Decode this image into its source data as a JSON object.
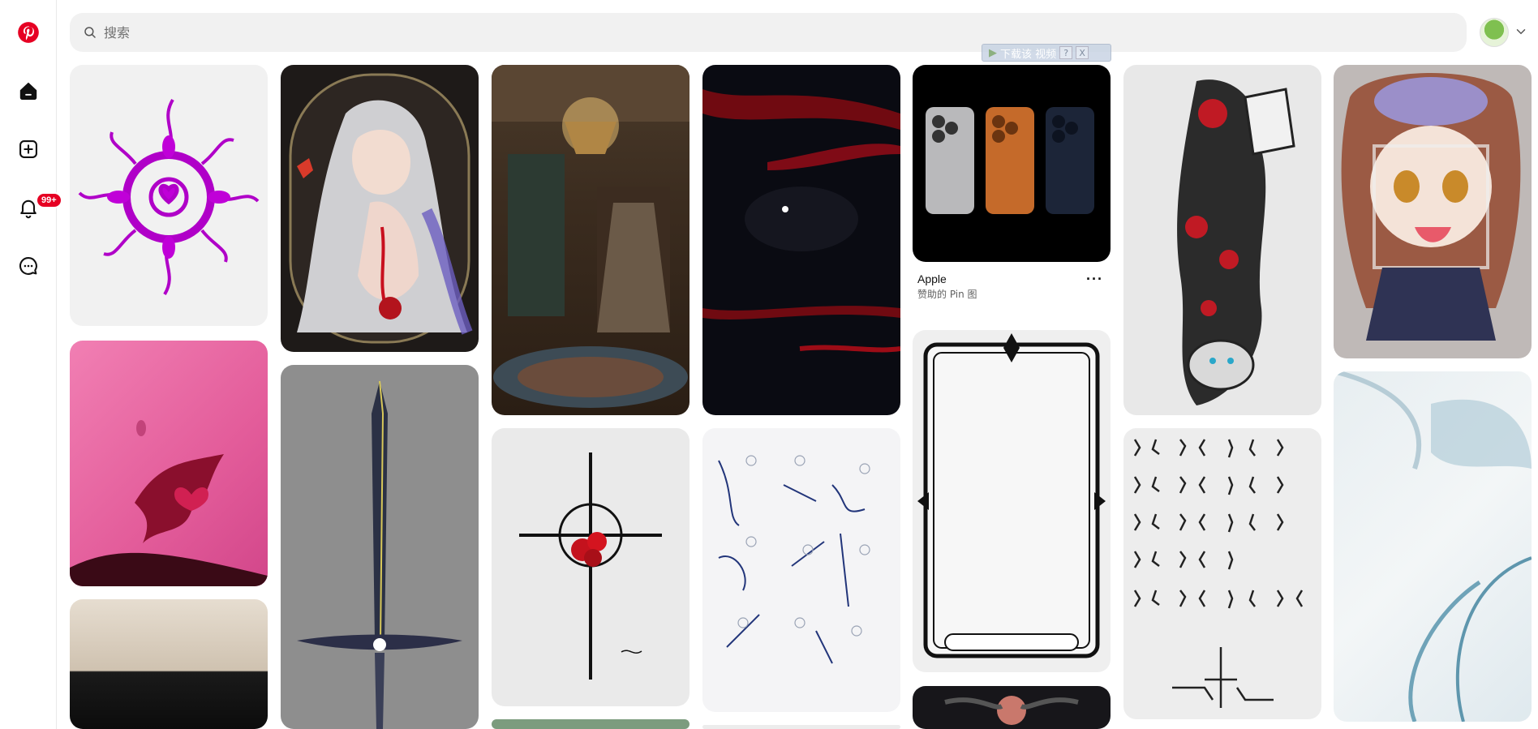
{
  "app": {
    "logo": "pinterest-logo-icon"
  },
  "sidebar": {
    "items": [
      {
        "icon": "home-icon"
      },
      {
        "icon": "create-icon"
      },
      {
        "icon": "notifications-icon",
        "badge": "99+"
      },
      {
        "icon": "messages-icon"
      }
    ]
  },
  "header": {
    "search_placeholder": "搜索",
    "download_bar": {
      "label": "下载该 视频",
      "help": "?",
      "close": "X"
    }
  },
  "pins": {
    "apple": {
      "title": "Apple",
      "subtitle": "赞助的 Pin 图",
      "more": "···"
    }
  },
  "colors": {
    "brand": "#e60023",
    "badge": "#e60023"
  }
}
